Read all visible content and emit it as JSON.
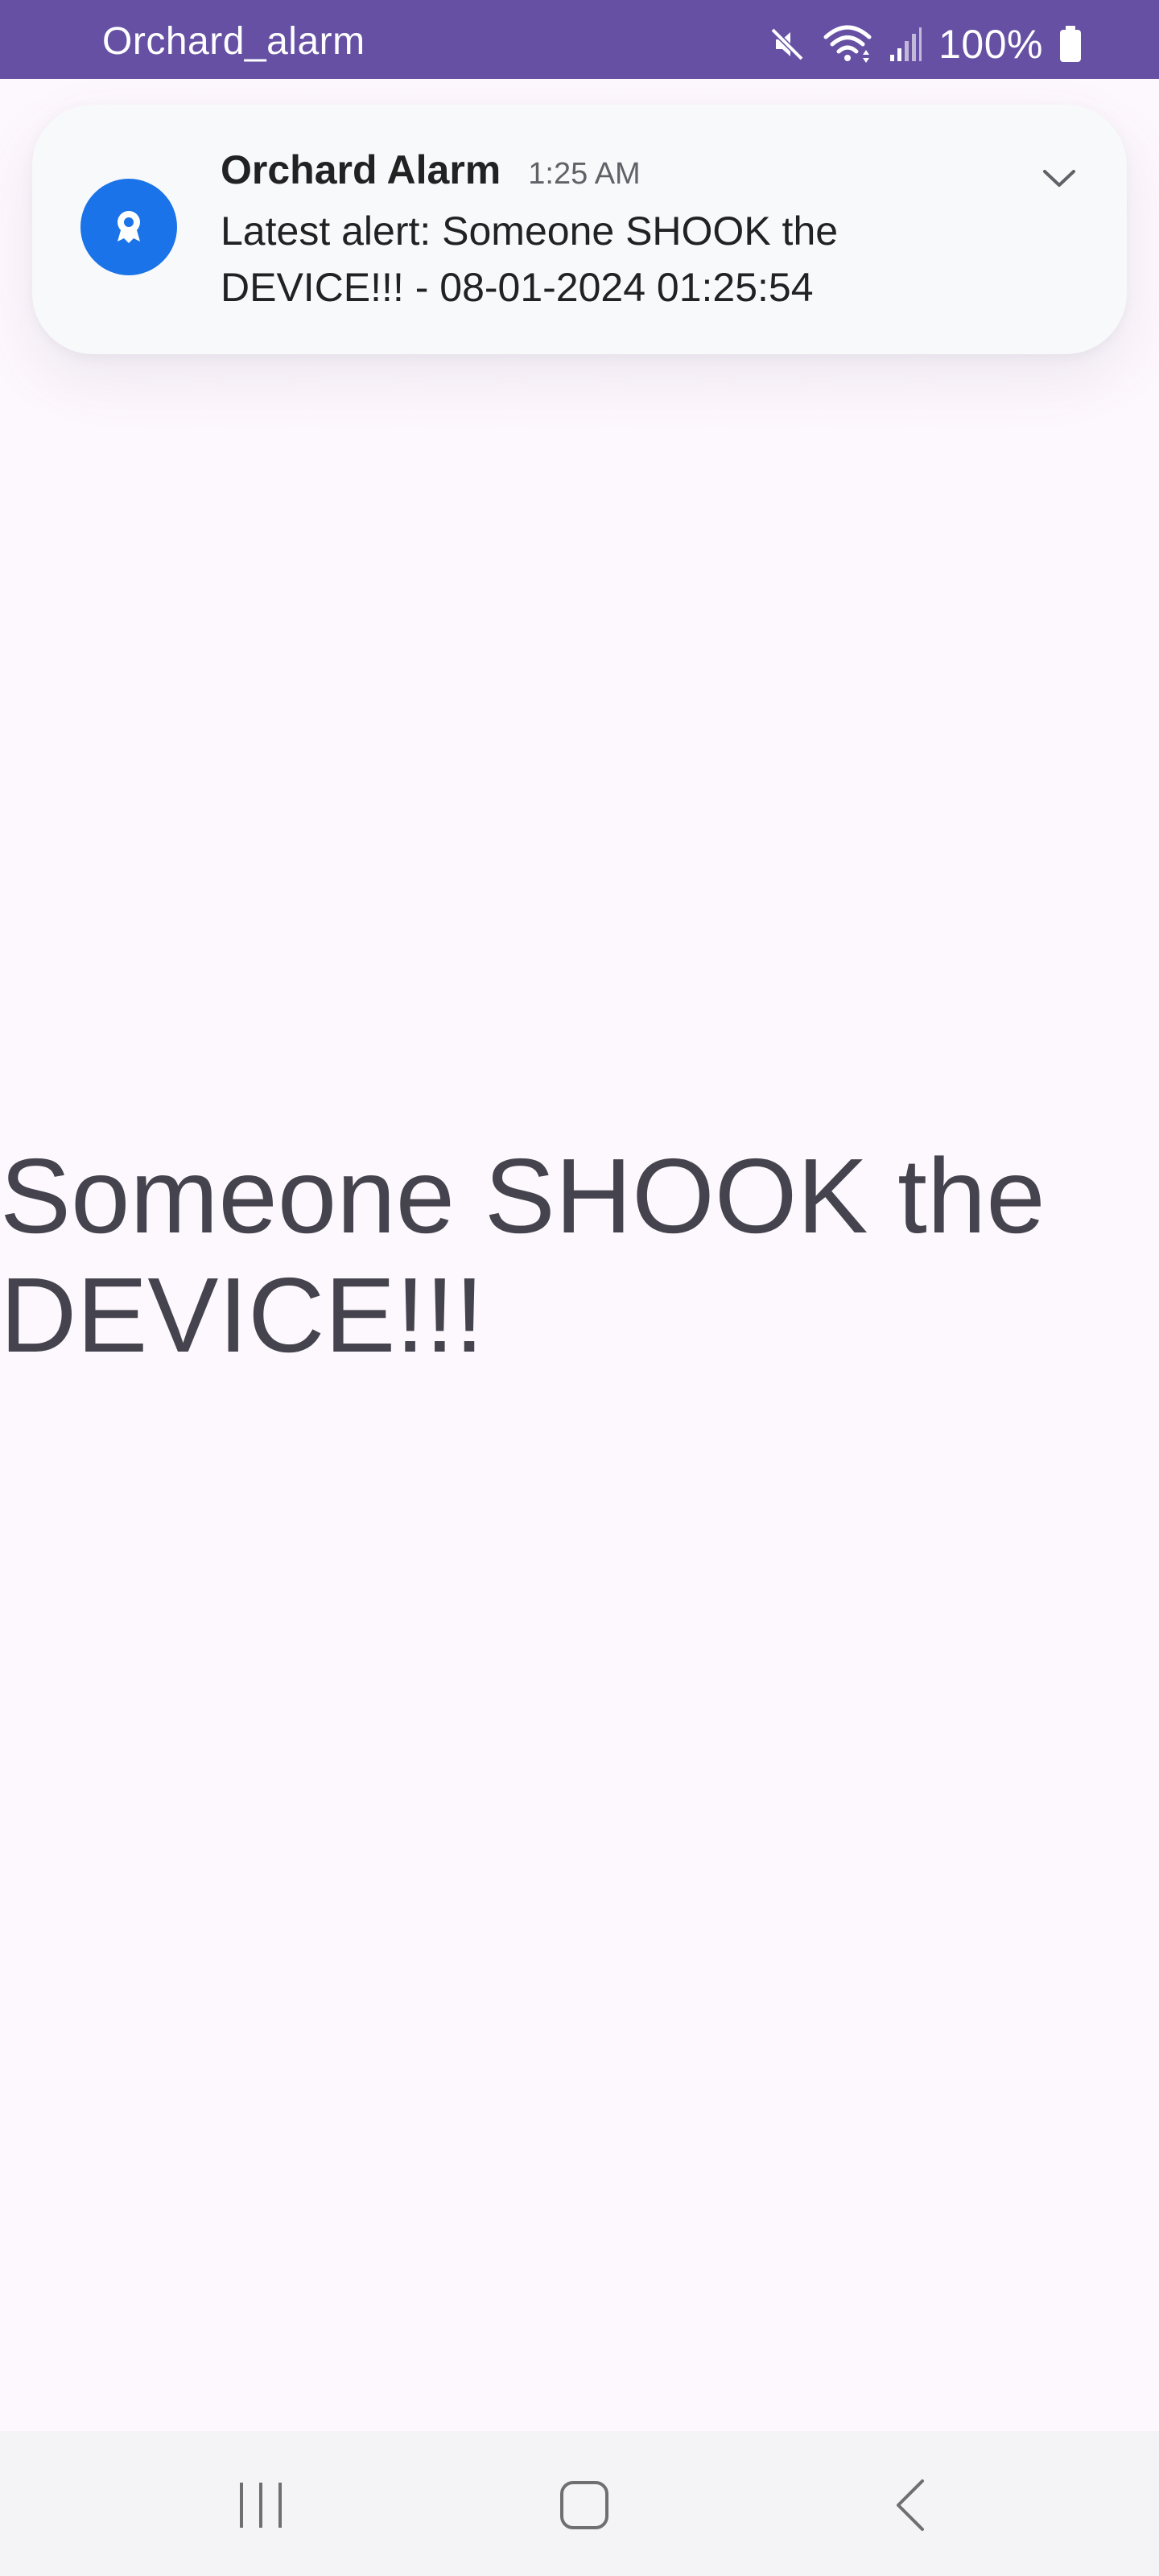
{
  "status_bar": {
    "app_name": "Orchard_alarm",
    "battery_percent": "100%",
    "icons": [
      "mute-icon",
      "wifi-icon",
      "signal-icon",
      "battery-icon"
    ],
    "background_color": "#6650a4"
  },
  "notification": {
    "app_name": "Orchard Alarm",
    "time": "1:25 AM",
    "body": "Latest alert: Someone SHOOK the DEVICE!!! - 08-01-2024 01:25:54",
    "icon": "app-badge-icon",
    "icon_color": "#1a73e8",
    "expand_icon": "chevron-down-icon"
  },
  "main": {
    "message": "Someone SHOOK the DEVICE!!!",
    "text_color": "#45434d",
    "background_color": "#fdf8fd"
  },
  "nav_bar": {
    "buttons": [
      "recent-apps-icon",
      "home-icon",
      "back-icon"
    ]
  }
}
